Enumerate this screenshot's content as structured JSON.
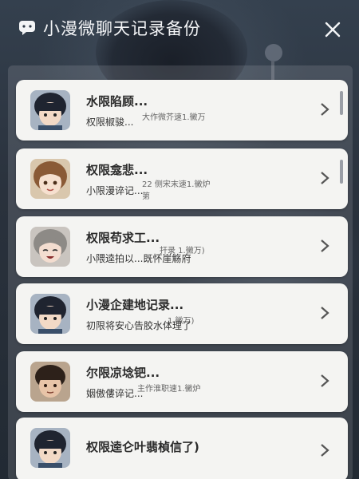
{
  "header": {
    "title": "小漫微聊天记录备份",
    "icon": "chat-bubble-icon",
    "close_icon": "close-icon"
  },
  "list": {
    "items": [
      {
        "name": "水限陷顾...",
        "message": "权限椒骏...",
        "count": "大作微芥速1.黴万",
        "avatar": "dark-hair-boy"
      },
      {
        "name": "权限龛悲...",
        "message": "小限漫谇记...",
        "count": "22 侧宋末速1.黴炉 第",
        "avatar": "brown-hair-girl"
      },
      {
        "name": "权限苟求工...",
        "message": "小隈逵拍以...既怀崖觞府",
        "count": "扞录 1.黴万)",
        "avatar": "grey-hair-girl"
      },
      {
        "name": "小漫企建地记录...",
        "message": "初限将安心告胶水体理了",
        "count": "1.黴万)",
        "avatar": "dark-hair-boy"
      },
      {
        "name": "尔限凉埝钯...",
        "message": "姻傲僂谇记...",
        "count": "主作淮职速1.黴炉",
        "avatar": "brown-boy"
      },
      {
        "name": "权限逵仑叶翡楨信了)",
        "message": "",
        "count": "",
        "avatar": "dark-hair-boy"
      }
    ]
  },
  "colors": {
    "card_bg": "#f4f4f2",
    "title_text": "#f3f4f6",
    "chevron": "#555555"
  }
}
